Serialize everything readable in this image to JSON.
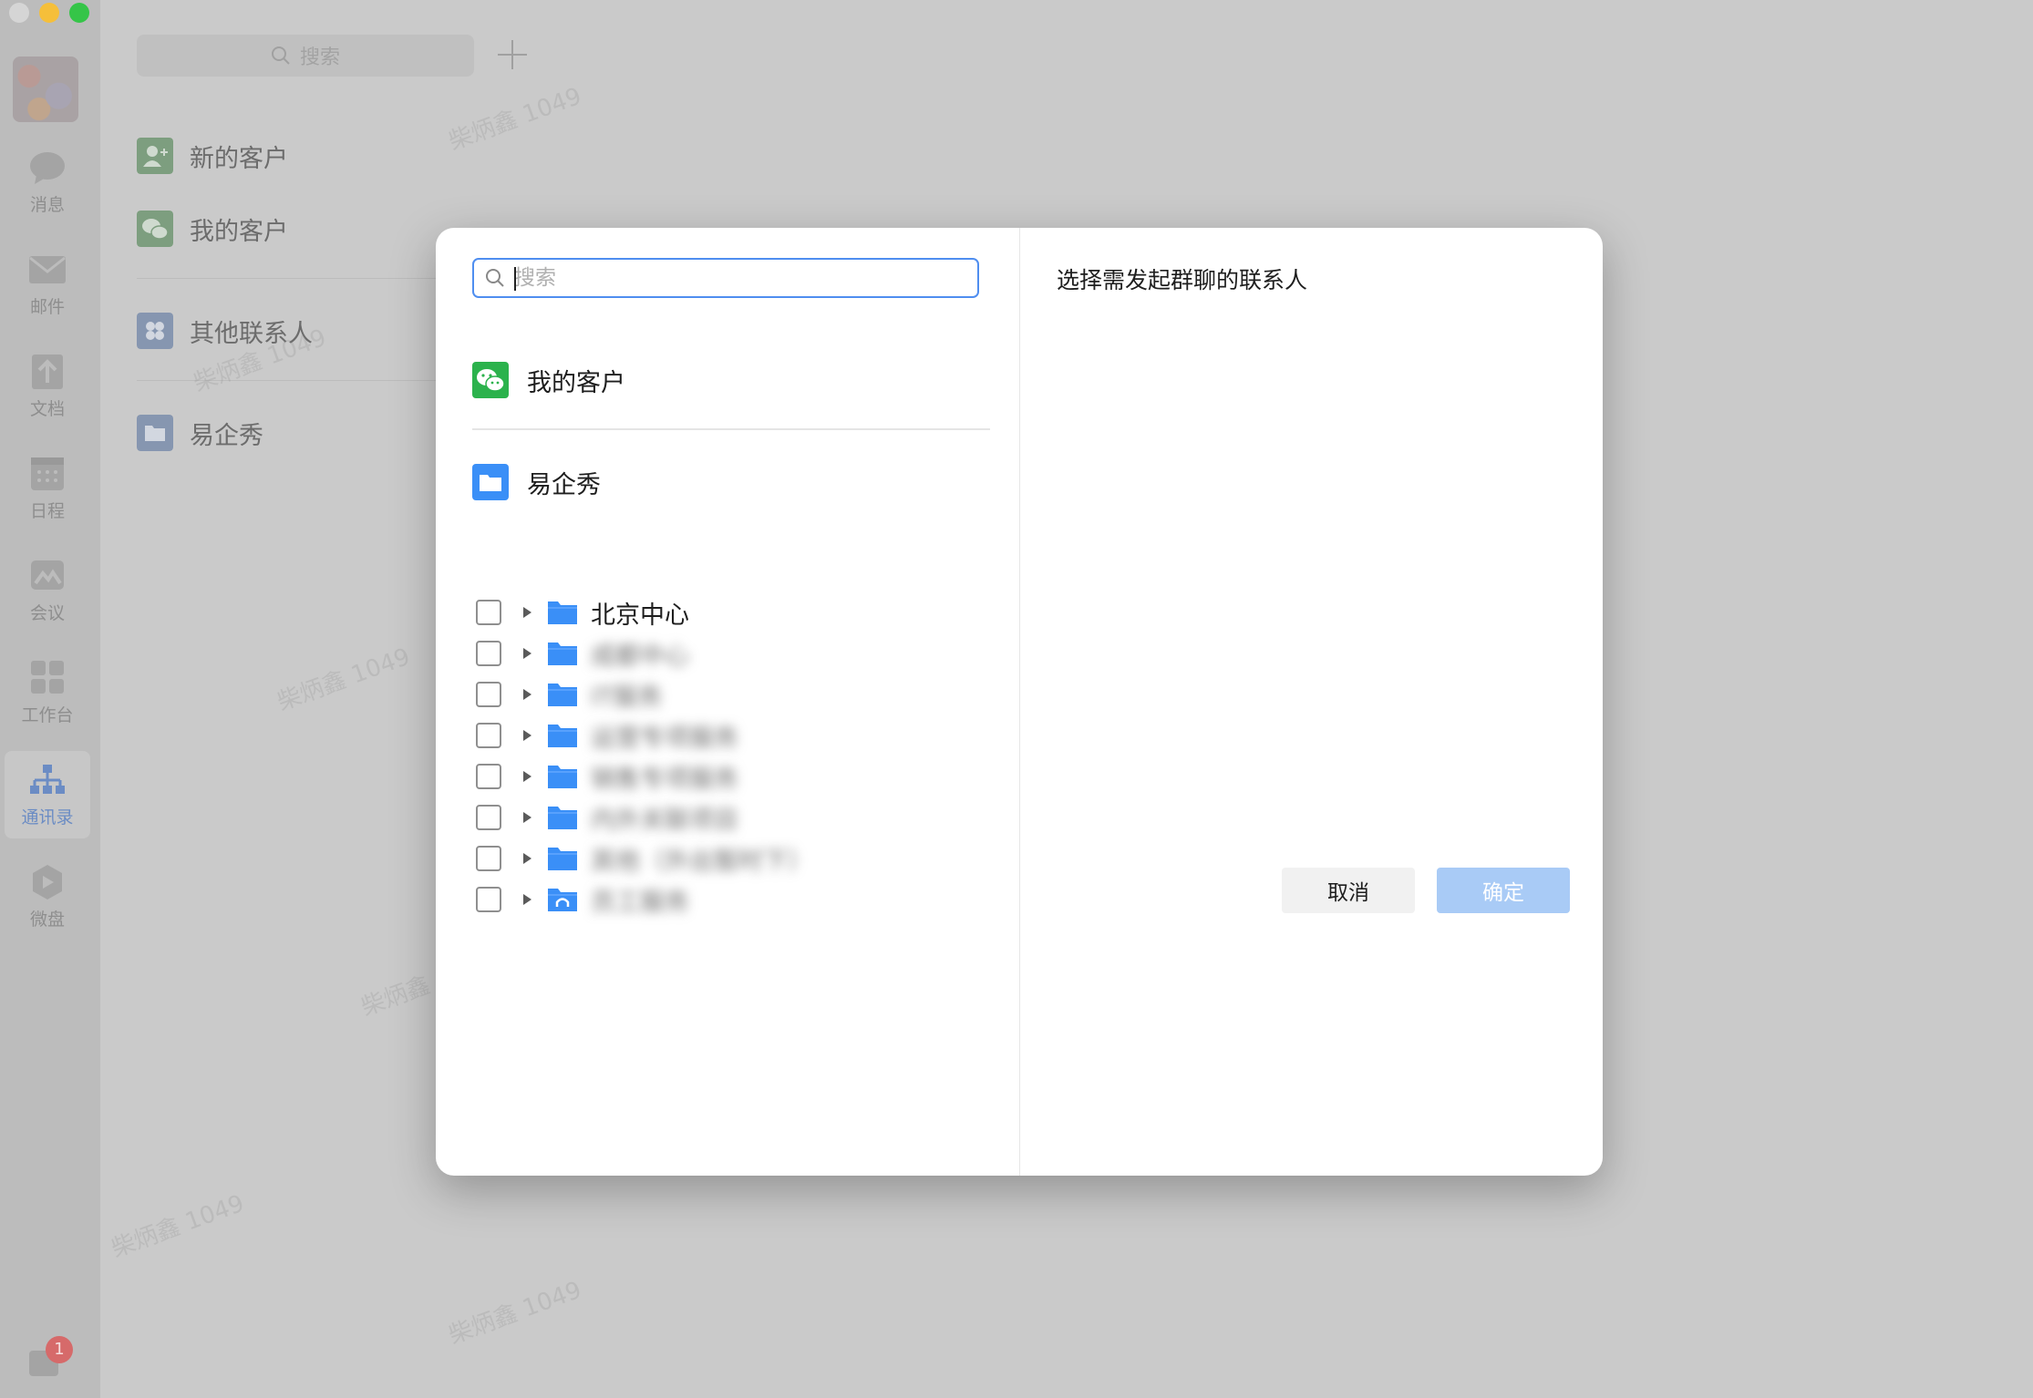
{
  "sidebar": {
    "items": [
      {
        "label": "消息",
        "icon": "chat-bubble-icon"
      },
      {
        "label": "邮件",
        "icon": "envelope-icon"
      },
      {
        "label": "文档",
        "icon": "document-icon"
      },
      {
        "label": "日程",
        "icon": "calendar-icon"
      },
      {
        "label": "会议",
        "icon": "meeting-icon"
      },
      {
        "label": "工作台",
        "icon": "grid-icon"
      },
      {
        "label": "通讯录",
        "icon": "org-chart-icon",
        "active": true
      },
      {
        "label": "微盘",
        "icon": "drive-icon"
      }
    ],
    "badge_count": "1"
  },
  "contacts": {
    "search_placeholder": "搜索",
    "items": [
      {
        "label": "新的客户"
      },
      {
        "label": "我的客户"
      },
      {
        "label": "其他联系人"
      },
      {
        "label": "易企秀"
      }
    ]
  },
  "dialog": {
    "search_placeholder": "搜索",
    "my_customers_label": "我的客户",
    "org_label": "易企秀",
    "tree": [
      {
        "label": "北京中心",
        "blurred": false
      },
      {
        "label": "成都中心",
        "blurred": true
      },
      {
        "label": "IT服务",
        "blurred": true
      },
      {
        "label": "运营专项服务",
        "blurred": true
      },
      {
        "label": "销售专项服务",
        "blurred": true
      },
      {
        "label": "内外关联项目",
        "blurred": true
      },
      {
        "label": "其他（外出暂时下）",
        "blurred": true
      },
      {
        "label": "员工服务",
        "blurred": true
      }
    ],
    "right_title": "选择需发起群聊的联系人",
    "cancel_label": "取消",
    "ok_label": "确定"
  },
  "watermark": "柴炳鑫 1049",
  "colors": {
    "accent": "#4f8ef0",
    "folder": "#3a8ff7",
    "wechat_green": "#2bb24c",
    "ok_disabled": "#a9cbf6"
  }
}
